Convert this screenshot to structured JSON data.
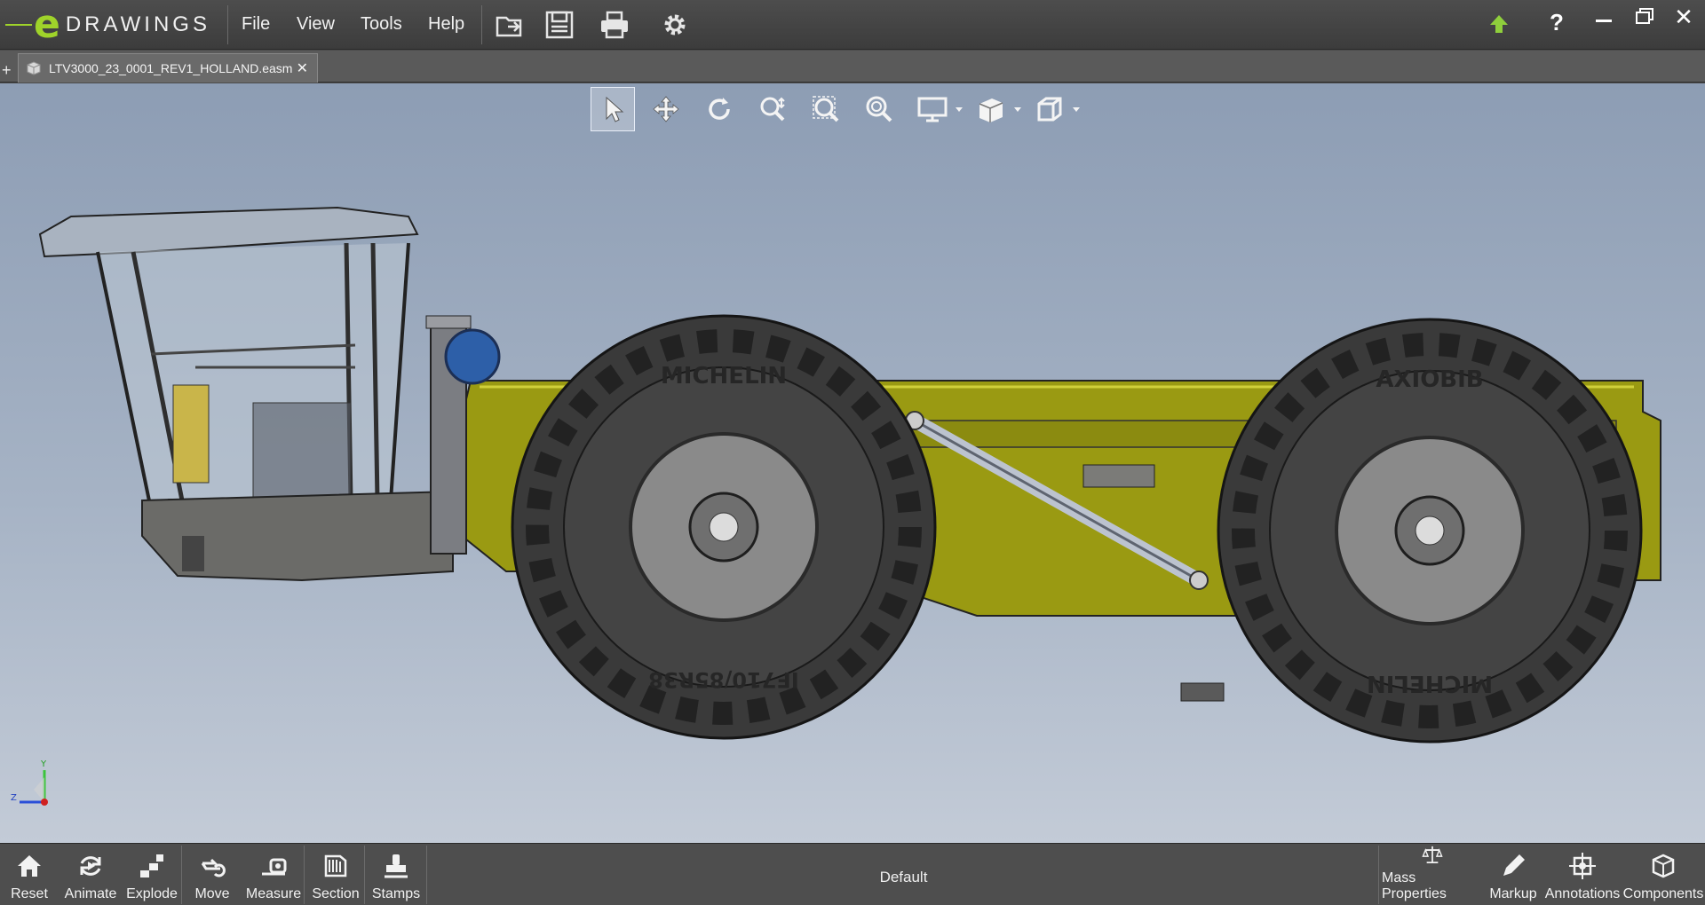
{
  "app": {
    "logo_word": "DRAWINGS",
    "logo_letter": "e"
  },
  "menu": {
    "file": "File",
    "view": "View",
    "tools": "Tools",
    "help": "Help"
  },
  "toolbar_icons": [
    "open-icon",
    "save-icon",
    "print-icon",
    "settings-icon"
  ],
  "window_controls": [
    "upload-icon",
    "help-icon",
    "minimize-icon",
    "restore-icon",
    "close-icon"
  ],
  "tab": {
    "plus": "+",
    "filename": "LTV3000_23_0001_REV1_HOLLAND.easm",
    "close": "✕"
  },
  "view_toolbar": [
    "select-icon",
    "pan-icon",
    "rotate-icon",
    "zoom-to-fit-icon",
    "zoom-to-area-icon",
    "zoom-icon",
    "display-style-icon",
    "views-icon",
    "view-orientation-icon"
  ],
  "triad": {
    "y": "Y",
    "z": "Z"
  },
  "bottom_left": [
    {
      "label": "Reset",
      "icon": "home-icon"
    },
    {
      "label": "Animate",
      "icon": "animate-icon"
    },
    {
      "label": "Explode",
      "icon": "explode-icon"
    },
    {
      "label": "Move",
      "icon": "move-icon"
    },
    {
      "label": "Measure",
      "icon": "measure-icon"
    },
    {
      "label": "Section",
      "icon": "section-icon"
    },
    {
      "label": "Stamps",
      "icon": "stamps-icon"
    }
  ],
  "configuration": "Default",
  "bottom_right": [
    {
      "label": "Mass Properties",
      "icon": "scale-icon"
    },
    {
      "label": "Markup",
      "icon": "pencil-icon"
    },
    {
      "label": "Annotations",
      "icon": "annotations-icon"
    },
    {
      "label": "Components",
      "icon": "components-icon"
    }
  ],
  "model": {
    "tire_brand": "MICHELIN",
    "tire_model": "AXIOBIB",
    "tire_size": "IF710/85R38",
    "body_color": "#9a9a12",
    "tire_color": "#3a3a3a"
  }
}
